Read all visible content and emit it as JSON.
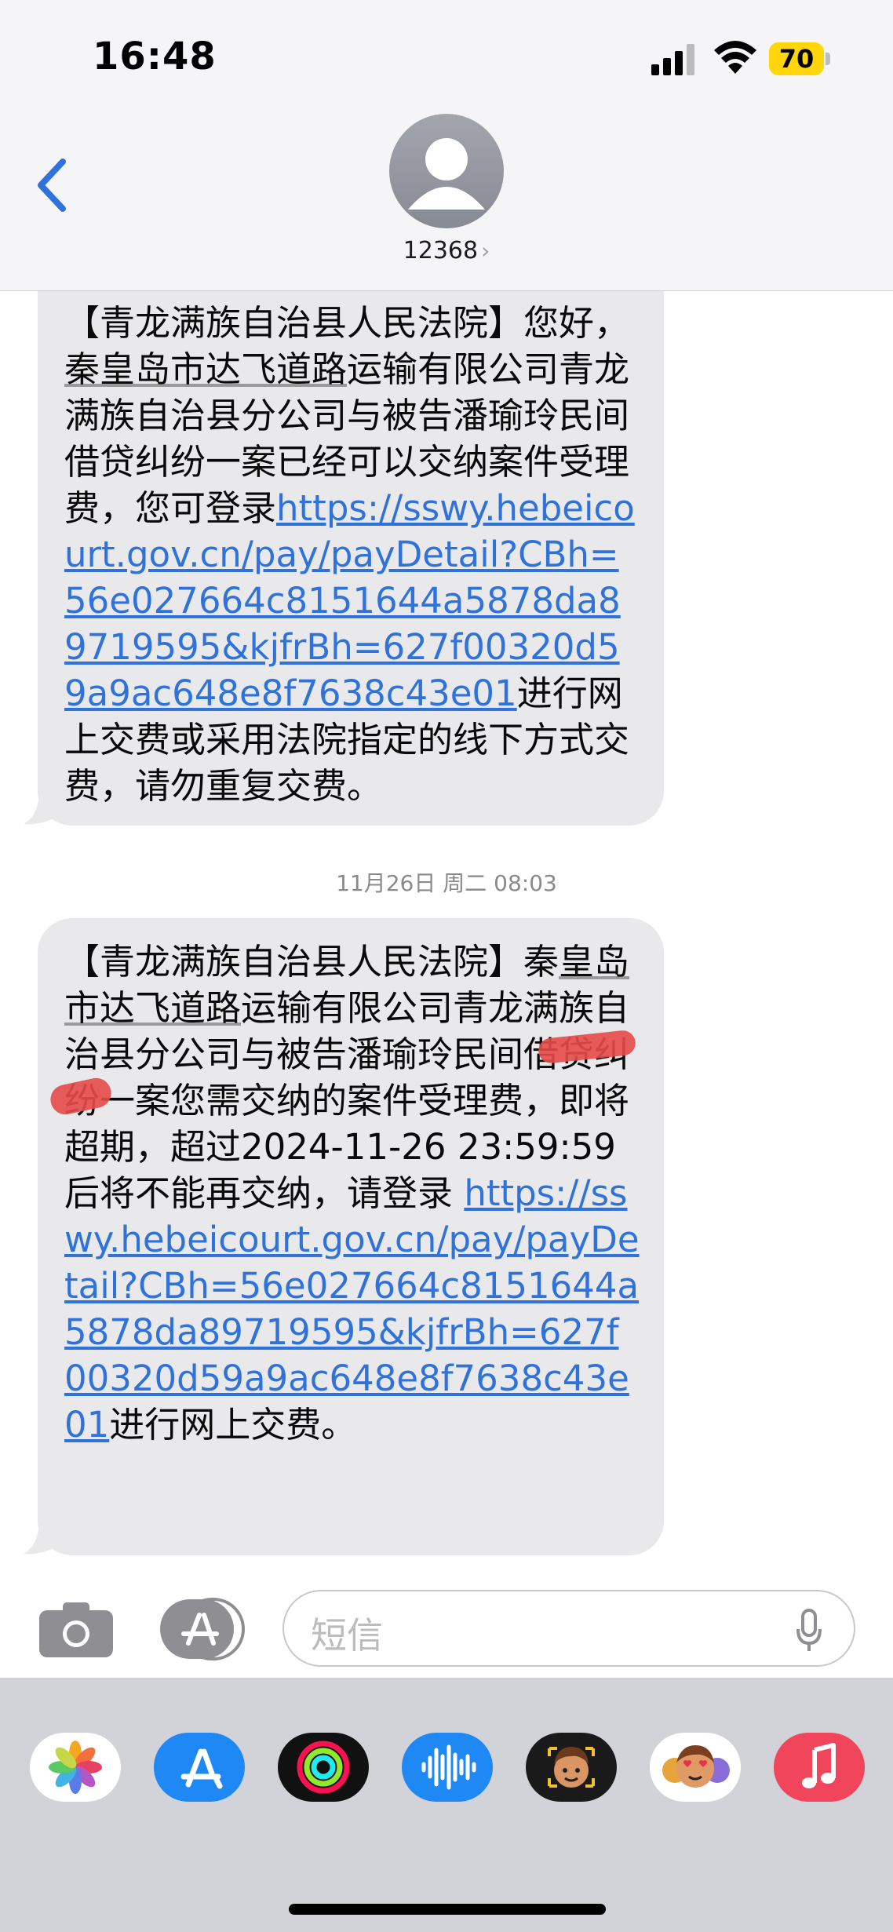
{
  "status_bar": {
    "time": "16:48",
    "battery_level": "70"
  },
  "header": {
    "contact": "12368",
    "chevron": "›"
  },
  "messages": [
    {
      "parts": [
        {
          "type": "text",
          "text": "【青龙满族自治县人民法院】您好，"
        },
        {
          "type": "text",
          "underline": true,
          "text": "秦皇岛市达飞道路"
        },
        {
          "type": "text",
          "text": "运输有限公司青龙满族自治县分公司与被告潘瑜玲民间借贷纠纷一案已经可以交纳案件受理费，您可登录"
        },
        {
          "type": "link",
          "text": "https://sswy.hebeicourt.gov.cn/pay/payDetail?CBh=56e027664c8151644a5878da89719595&kjfrBh=627f00320d59a9ac648e8f7638c43e01"
        },
        {
          "type": "text",
          "text": "进行网上交费或采用法院指定的线下方式交费，请勿重复交费。"
        }
      ]
    },
    {
      "parts": [
        {
          "type": "text",
          "text": "【青龙满族自治县人民法院】秦"
        },
        {
          "type": "text",
          "underline": true,
          "text": "皇岛市达飞道路"
        },
        {
          "type": "text",
          "text": "运输有限公司青龙满族自治县分公司与被告潘瑜玲民间借贷纠纷一案您需交纳的案件受理费，即将超期，超过2024-11-26 23:59:59后将不能再交纳，请登录 "
        },
        {
          "type": "link",
          "text": "https://sswy.hebeicourt.gov.cn/pay/payDetail?CBh=56e027664c8151644a5878da89719595&kjfrBh=627f00320d59a9ac648e8f7638c43e01"
        },
        {
          "type": "text",
          "text": "进行网上交费。"
        }
      ]
    }
  ],
  "timestamp": "11月26日 周二 08:03",
  "input": {
    "placeholder": "短信"
  },
  "apps": [
    {
      "name": "photos-app-icon",
      "color": "#ffffff"
    },
    {
      "name": "app-store-app-icon",
      "color": "#1e88f5"
    },
    {
      "name": "fitness-app-icon",
      "color": "#111111"
    },
    {
      "name": "audio-message-app-icon",
      "color": "#1e88f5"
    },
    {
      "name": "memoji-app-icon",
      "color": "#1a1a1a"
    },
    {
      "name": "memoji-stickers-app-icon",
      "color": "#ffffff"
    },
    {
      "name": "music-app-icon",
      "color": "#f0455a"
    }
  ]
}
